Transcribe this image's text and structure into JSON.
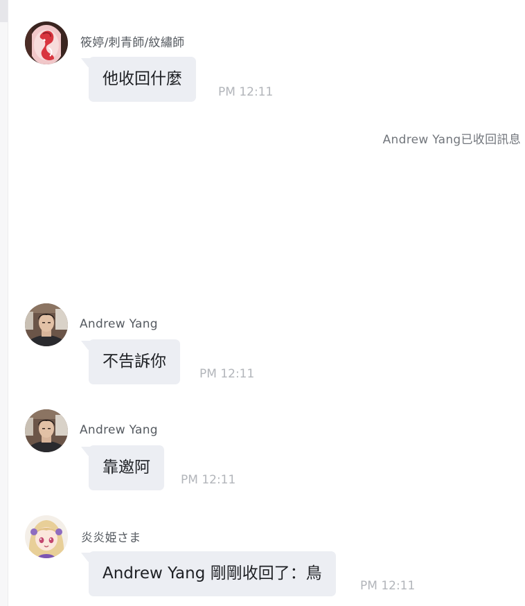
{
  "messages": [
    {
      "sender": "筱婷/刺青師/紋繡師",
      "text": "他收回什麼",
      "time": "PM 12:11",
      "avatar_icon": "tattoo-artist-avatar-icon"
    },
    {
      "sender": "Andrew Yang",
      "text": "不告訴你",
      "time": "PM 12:11",
      "avatar_icon": "man-photo-avatar-icon"
    },
    {
      "sender": "Andrew Yang",
      "text": "靠邀阿",
      "time": "PM 12:11",
      "avatar_icon": "man-photo-avatar-icon"
    },
    {
      "sender": "炎炎姫さま",
      "text": "Andrew Yang 剛剛收回了：鳥",
      "time": "PM 12:11",
      "avatar_icon": "anime-girl-avatar-icon"
    }
  ],
  "system_notice": "Andrew Yang已收回訊息",
  "colors": {
    "bubble": "#eceef3",
    "time": "#b2b5ba",
    "sender": "#555a60",
    "notice": "#72767c"
  }
}
